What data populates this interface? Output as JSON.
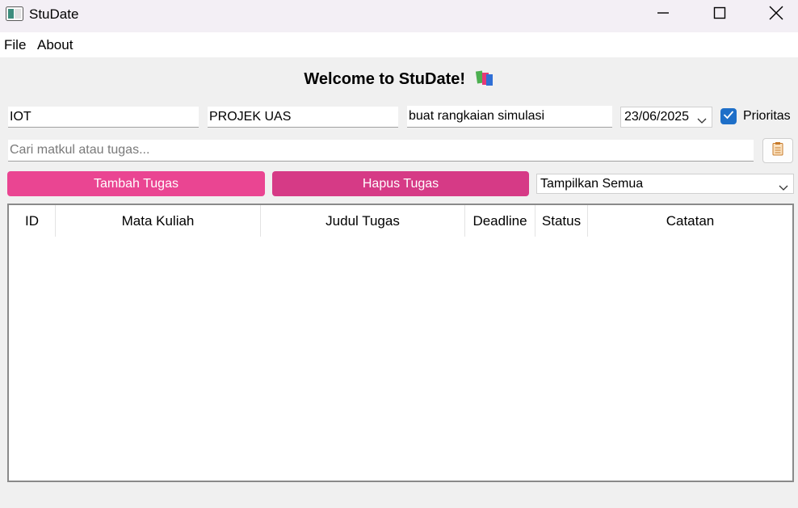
{
  "window": {
    "title": "StuDate"
  },
  "menu": {
    "file": "File",
    "about": "About"
  },
  "welcome": "Welcome to StuDate!",
  "form": {
    "matkul_value": "IOT",
    "judul_value": "PROJEK UAS",
    "catatan_value": "buat rangkaian simulasi",
    "deadline_value": "23/06/2025",
    "prioritas_label": "Prioritas",
    "prioritas_checked": true,
    "search_placeholder": "Cari matkul atau tugas..."
  },
  "buttons": {
    "add": "Tambah Tugas",
    "delete": "Hapus Tugas"
  },
  "filter": {
    "selected": "Tampilkan Semua"
  },
  "table": {
    "columns": [
      "ID",
      "Mata Kuliah",
      "Judul Tugas",
      "Deadline",
      "Status",
      "Catatan"
    ]
  },
  "colors": {
    "add_button": "#ea4592",
    "delete_button": "#d63a86",
    "checkbox": "#1e6fc8"
  },
  "icons": [
    "app-window-icon",
    "minimize-icon",
    "maximize-icon",
    "close-icon",
    "books-emoji-icon",
    "chevron-down-icon",
    "checkmark-icon",
    "clipboard-icon"
  ]
}
